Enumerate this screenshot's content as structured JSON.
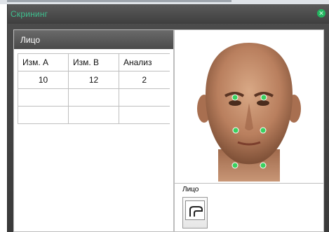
{
  "window": {
    "title": "Скрининг",
    "close_icon": "close-icon",
    "accent_color": "#3fbf8f"
  },
  "left_panel": {
    "title": "Лицо",
    "table": {
      "headers": [
        "Изм. А",
        "Изм. В",
        "Анализ"
      ],
      "rows": [
        [
          "10",
          "12",
          "2"
        ],
        [
          "",
          "",
          ""
        ],
        [
          "",
          "",
          ""
        ]
      ]
    }
  },
  "right_panel": {
    "section_label": "Лицо",
    "marker_color": "#39d15f",
    "button_icon": "profile-face-icon"
  }
}
